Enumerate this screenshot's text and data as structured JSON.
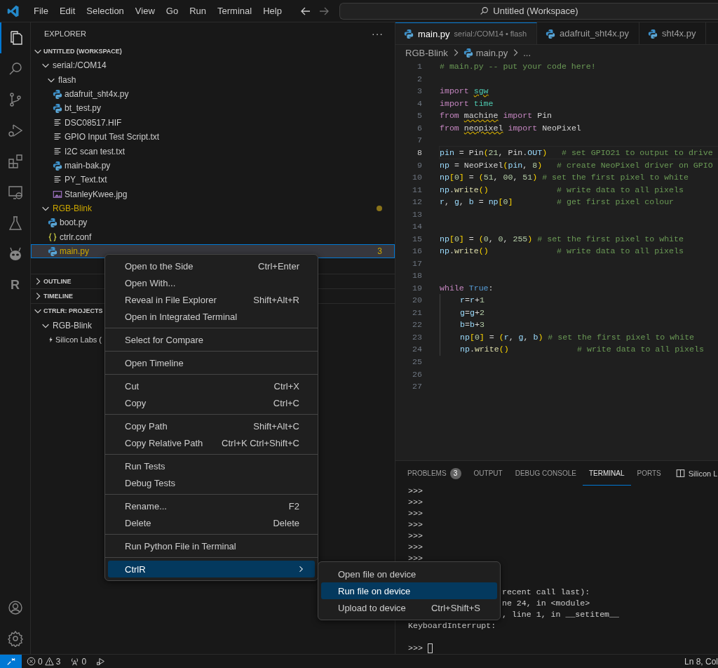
{
  "title_bar": {
    "menus": [
      "File",
      "Edit",
      "Selection",
      "View",
      "Go",
      "Run",
      "Terminal",
      "Help"
    ],
    "search": "Untitled (Workspace)"
  },
  "activity_bar": {
    "items": [
      {
        "kind": "files",
        "selected": true
      },
      {
        "kind": "search",
        "selected": false
      },
      {
        "kind": "source-control",
        "selected": false
      },
      {
        "kind": "run-debug",
        "selected": false
      },
      {
        "kind": "extensions",
        "selected": false
      },
      {
        "kind": "remote",
        "selected": false
      },
      {
        "kind": "testing",
        "selected": false
      },
      {
        "kind": "alien",
        "selected": false
      },
      {
        "kind": "letter",
        "text": "R",
        "selected": false
      }
    ],
    "bottom": [
      {
        "kind": "account"
      },
      {
        "kind": "settings"
      }
    ]
  },
  "sidebar": {
    "title": "EXPLORER",
    "more": "···",
    "sections": [
      {
        "title": "UNTITLED (WORKSPACE)",
        "expanded": true,
        "tree": [
          {
            "label": "serial:/COM14",
            "kind": "folder",
            "expanded": true,
            "selected": false,
            "warning": false,
            "children": [
              {
                "label": "flash",
                "kind": "folder",
                "expanded": true,
                "selected": false,
                "warning": false,
                "children": [
                  {
                    "label": "adafruit_sht4x.py",
                    "kind": "python",
                    "selected": false,
                    "warning": false
                  },
                  {
                    "label": "bt_test.py",
                    "kind": "python",
                    "selected": false,
                    "warning": false
                  },
                  {
                    "label": "DSC08517.HIF",
                    "kind": "text",
                    "selected": false,
                    "warning": false
                  },
                  {
                    "label": "GPIO Input Test Script.txt",
                    "kind": "text",
                    "selected": false,
                    "warning": false
                  },
                  {
                    "label": "I2C scan test.txt",
                    "kind": "text",
                    "selected": false,
                    "warning": false
                  },
                  {
                    "label": "main-bak.py",
                    "kind": "python",
                    "selected": false,
                    "warning": false
                  },
                  {
                    "label": "PY_Text.txt",
                    "kind": "text",
                    "selected": false,
                    "warning": false
                  },
                  {
                    "label": "StanleyKwee.jpg",
                    "kind": "image",
                    "selected": false,
                    "warning": false
                  }
                ]
              }
            ]
          },
          {
            "label": "RGB-Blink",
            "kind": "folder",
            "expanded": true,
            "selected": false,
            "warning": true,
            "children": [
              {
                "label": "boot.py",
                "kind": "python",
                "selected": false,
                "warning": false
              },
              {
                "label": "ctrlr.conf",
                "kind": "json",
                "selected": false,
                "warning": false
              },
              {
                "label": "main.py",
                "kind": "python",
                "selected": true,
                "warning": true,
                "problems": "3"
              }
            ]
          }
        ]
      },
      {
        "title": "OUTLINE",
        "expanded": false
      },
      {
        "title": "TIMELINE",
        "expanded": false
      },
      {
        "title": "CTRLR: PROJECTS",
        "expanded": true,
        "tree": [
          {
            "label": "RGB-Blink",
            "kind": "folder",
            "expanded": true,
            "selected": false,
            "warning": false,
            "children": [
              {
                "label": "Silicon Labs (",
                "kind": "device",
                "selected": false,
                "warning": false
              }
            ]
          }
        ]
      }
    ]
  },
  "editor": {
    "tabs": [
      {
        "label": "main.py",
        "description": "serial:/COM14 • flash",
        "selected": true
      },
      {
        "label": "adafruit_sht4x.py",
        "selected": false
      },
      {
        "label": "sht4x.py",
        "selected": false
      }
    ],
    "breadcrumb": [
      {
        "label": "RGB-Blink",
        "kind": "folder"
      },
      {
        "label": "main.py",
        "kind": "python"
      },
      {
        "label": "...",
        "kind": "more"
      }
    ],
    "lines": [
      {
        "number": "1",
        "current": false,
        "indented": false,
        "tokens": [
          {
            "kind": "c",
            "text": "# main.py -- put your code here!"
          }
        ]
      },
      {
        "number": "2",
        "current": false,
        "indented": false
      },
      {
        "number": "3",
        "current": false,
        "indented": false,
        "tokens": [
          {
            "kind": "k",
            "text": "import "
          },
          {
            "kind": "mw",
            "text": "sgw"
          }
        ]
      },
      {
        "number": "4",
        "current": false,
        "indented": false,
        "tokens": [
          {
            "kind": "k",
            "text": "import "
          },
          {
            "kind": "m",
            "text": "time"
          }
        ]
      },
      {
        "number": "5",
        "current": false,
        "indented": false,
        "tokens": [
          {
            "kind": "k",
            "text": "from "
          },
          {
            "kind": "pw",
            "text": "machine"
          },
          {
            "kind": "k",
            "text": " import "
          },
          {
            "kind": "t",
            "text": "Pin"
          }
        ]
      },
      {
        "number": "6",
        "current": false,
        "indented": false,
        "tokens": [
          {
            "kind": "k",
            "text": "from "
          },
          {
            "kind": "pw",
            "text": "neopixel"
          },
          {
            "kind": "k",
            "text": " import "
          },
          {
            "kind": "t",
            "text": "NeoPixel"
          }
        ]
      },
      {
        "number": "7",
        "current": false,
        "indented": false
      },
      {
        "number": "8",
        "current": true,
        "indented": false,
        "tokens": [
          {
            "kind": "v",
            "text": "pin"
          },
          {
            "kind": "o",
            "text": " = "
          },
          {
            "kind": "t",
            "text": "Pin"
          },
          {
            "kind": "b",
            "text": "("
          },
          {
            "kind": "n",
            "text": "21"
          },
          {
            "kind": "o",
            "text": ", "
          },
          {
            "kind": "t",
            "text": "Pin"
          },
          {
            "kind": "o",
            "text": "."
          },
          {
            "kind": "v",
            "text": "OUT"
          },
          {
            "kind": "b",
            "text": ")"
          },
          {
            "kind": "c",
            "text": "   # set GPIO21 to output to drive"
          }
        ]
      },
      {
        "number": "9",
        "current": false,
        "indented": false,
        "tokens": [
          {
            "kind": "v",
            "text": "np"
          },
          {
            "kind": "o",
            "text": " = "
          },
          {
            "kind": "t",
            "text": "NeoPixel"
          },
          {
            "kind": "b",
            "text": "("
          },
          {
            "kind": "v",
            "text": "pin"
          },
          {
            "kind": "o",
            "text": ", "
          },
          {
            "kind": "n",
            "text": "8"
          },
          {
            "kind": "b",
            "text": ")"
          },
          {
            "kind": "c",
            "text": "   # create NeoPixel driver on GPIO"
          }
        ]
      },
      {
        "number": "10",
        "current": false,
        "indented": false,
        "tokens": [
          {
            "kind": "v",
            "text": "np"
          },
          {
            "kind": "b",
            "text": "["
          },
          {
            "kind": "n",
            "text": "0"
          },
          {
            "kind": "b",
            "text": "]"
          },
          {
            "kind": "o",
            "text": " = "
          },
          {
            "kind": "b",
            "text": "("
          },
          {
            "kind": "n",
            "text": "51"
          },
          {
            "kind": "o",
            "text": ", "
          },
          {
            "kind": "n",
            "text": "00"
          },
          {
            "kind": "o",
            "text": ", "
          },
          {
            "kind": "n",
            "text": "51"
          },
          {
            "kind": "b",
            "text": ")"
          },
          {
            "kind": "c",
            "text": " # set the first pixel to white"
          }
        ]
      },
      {
        "number": "11",
        "current": false,
        "indented": false,
        "tokens": [
          {
            "kind": "v",
            "text": "np"
          },
          {
            "kind": "o",
            "text": "."
          },
          {
            "kind": "f",
            "text": "write"
          },
          {
            "kind": "b",
            "text": "()"
          },
          {
            "kind": "c",
            "text": "              # write data to all pixels"
          }
        ]
      },
      {
        "number": "12",
        "current": false,
        "indented": false,
        "tokens": [
          {
            "kind": "v",
            "text": "r"
          },
          {
            "kind": "o",
            "text": ", "
          },
          {
            "kind": "v",
            "text": "g"
          },
          {
            "kind": "o",
            "text": ", "
          },
          {
            "kind": "v",
            "text": "b"
          },
          {
            "kind": "o",
            "text": " = "
          },
          {
            "kind": "v",
            "text": "np"
          },
          {
            "kind": "b",
            "text": "["
          },
          {
            "kind": "n",
            "text": "0"
          },
          {
            "kind": "b",
            "text": "]"
          },
          {
            "kind": "c",
            "text": "         # get first pixel colour"
          }
        ]
      },
      {
        "number": "13",
        "current": false,
        "indented": false
      },
      {
        "number": "14",
        "current": false,
        "indented": false
      },
      {
        "number": "15",
        "current": false,
        "indented": false,
        "tokens": [
          {
            "kind": "v",
            "text": "np"
          },
          {
            "kind": "b",
            "text": "["
          },
          {
            "kind": "n",
            "text": "0"
          },
          {
            "kind": "b",
            "text": "]"
          },
          {
            "kind": "o",
            "text": " = "
          },
          {
            "kind": "b",
            "text": "("
          },
          {
            "kind": "n",
            "text": "0"
          },
          {
            "kind": "o",
            "text": ", "
          },
          {
            "kind": "n",
            "text": "0"
          },
          {
            "kind": "o",
            "text": ", "
          },
          {
            "kind": "n",
            "text": "255"
          },
          {
            "kind": "b",
            "text": ")"
          },
          {
            "kind": "c",
            "text": " # set the first pixel to white"
          }
        ]
      },
      {
        "number": "16",
        "current": false,
        "indented": false,
        "tokens": [
          {
            "kind": "v",
            "text": "np"
          },
          {
            "kind": "o",
            "text": "."
          },
          {
            "kind": "f",
            "text": "write"
          },
          {
            "kind": "b",
            "text": "()"
          },
          {
            "kind": "c",
            "text": "              # write data to all pixels"
          }
        ]
      },
      {
        "number": "17",
        "current": false,
        "indented": false
      },
      {
        "number": "18",
        "current": false,
        "indented": false
      },
      {
        "number": "19",
        "current": false,
        "indented": false,
        "tokens": [
          {
            "kind": "k",
            "text": "while "
          },
          {
            "kind": "q",
            "text": "True"
          },
          {
            "kind": "o",
            "text": ":"
          }
        ]
      },
      {
        "number": "20",
        "current": false,
        "indented": true,
        "tokens": [
          {
            "kind": "v",
            "text": "r"
          },
          {
            "kind": "o",
            "text": "="
          },
          {
            "kind": "v",
            "text": "r"
          },
          {
            "kind": "o",
            "text": "+"
          },
          {
            "kind": "n",
            "text": "1"
          }
        ]
      },
      {
        "number": "21",
        "current": false,
        "indented": true,
        "tokens": [
          {
            "kind": "v",
            "text": "g"
          },
          {
            "kind": "o",
            "text": "="
          },
          {
            "kind": "v",
            "text": "g"
          },
          {
            "kind": "o",
            "text": "+"
          },
          {
            "kind": "n",
            "text": "2"
          }
        ]
      },
      {
        "number": "22",
        "current": false,
        "indented": true,
        "tokens": [
          {
            "kind": "v",
            "text": "b"
          },
          {
            "kind": "o",
            "text": "="
          },
          {
            "kind": "v",
            "text": "b"
          },
          {
            "kind": "o",
            "text": "+"
          },
          {
            "kind": "n",
            "text": "3"
          }
        ]
      },
      {
        "number": "23",
        "current": false,
        "indented": true,
        "tokens": [
          {
            "kind": "v",
            "text": "np"
          },
          {
            "kind": "b",
            "text": "["
          },
          {
            "kind": "n",
            "text": "0"
          },
          {
            "kind": "b",
            "text": "]"
          },
          {
            "kind": "o",
            "text": " = "
          },
          {
            "kind": "b",
            "text": "("
          },
          {
            "kind": "v",
            "text": "r"
          },
          {
            "kind": "o",
            "text": ", "
          },
          {
            "kind": "v",
            "text": "g"
          },
          {
            "kind": "o",
            "text": ", "
          },
          {
            "kind": "v",
            "text": "b"
          },
          {
            "kind": "b",
            "text": ")"
          },
          {
            "kind": "c",
            "text": " # set the first pixel to white"
          }
        ]
      },
      {
        "number": "24",
        "current": false,
        "indented": true,
        "tokens": [
          {
            "kind": "v",
            "text": "np"
          },
          {
            "kind": "o",
            "text": "."
          },
          {
            "kind": "f",
            "text": "write"
          },
          {
            "kind": "b",
            "text": "()"
          },
          {
            "kind": "c",
            "text": "              # write data to all pixels"
          }
        ]
      },
      {
        "number": "25",
        "current": false,
        "indented": false
      },
      {
        "number": "26",
        "current": false,
        "indented": false
      },
      {
        "number": "27",
        "current": false,
        "indented": false
      }
    ]
  },
  "panel": {
    "tabs": [
      {
        "label": "PROBLEMS",
        "badge": "3",
        "selected": false
      },
      {
        "label": "OUTPUT",
        "selected": false
      },
      {
        "label": "DEBUG CONSOLE",
        "selected": false
      },
      {
        "label": "TERMINAL",
        "selected": true
      },
      {
        "label": "PORTS",
        "selected": false
      }
    ],
    "terminal_name": "Silicon L",
    "terminal": [
      {
        "text": ">>>",
        "kind": "full"
      },
      {
        "text": ">>>",
        "kind": "full"
      },
      {
        "text": ">>>",
        "kind": "full"
      },
      {
        "text": ">>>",
        "kind": "full"
      },
      {
        "text": ">>>",
        "kind": "full"
      },
      {
        "text": ">>>",
        "kind": "full"
      },
      {
        "text": ">>>",
        "kind": "full"
      },
      {
        "text": "recent call last):",
        "kind": "partial"
      },
      {
        "text": "ne 24, in <module>",
        "kind": "partial"
      },
      {
        "text": ", line 1, in __setitem__",
        "kind": "partial"
      },
      {
        "text": "KeyboardInterrupt:",
        "kind": "full"
      },
      {
        "text": ">>>",
        "kind": "prompt"
      }
    ]
  },
  "context_menu": {
    "groups": [
      [
        {
          "label": "Open to the Side",
          "shortcut": "Ctrl+Enter",
          "selected": false
        },
        {
          "label": "Open With...",
          "selected": false
        },
        {
          "label": "Reveal in File Explorer",
          "shortcut": "Shift+Alt+R",
          "selected": false
        },
        {
          "label": "Open in Integrated Terminal",
          "selected": false
        }
      ],
      [
        {
          "label": "Select for Compare",
          "selected": false
        }
      ],
      [
        {
          "label": "Open Timeline",
          "selected": false
        }
      ],
      [
        {
          "label": "Cut",
          "shortcut": "Ctrl+X",
          "selected": false
        },
        {
          "label": "Copy",
          "shortcut": "Ctrl+C",
          "selected": false
        }
      ],
      [
        {
          "label": "Copy Path",
          "shortcut": "Shift+Alt+C",
          "selected": false
        },
        {
          "label": "Copy Relative Path",
          "shortcut": "Ctrl+K Ctrl+Shift+C",
          "selected": false
        }
      ],
      [
        {
          "label": "Run Tests",
          "selected": false
        },
        {
          "label": "Debug Tests",
          "selected": false
        }
      ],
      [
        {
          "label": "Rename...",
          "shortcut": "F2",
          "selected": false
        },
        {
          "label": "Delete",
          "shortcut": "Delete",
          "selected": false
        }
      ],
      [
        {
          "label": "Run Python File in Terminal",
          "selected": false
        }
      ],
      [
        {
          "label": "CtrlR",
          "submenu": true,
          "selected": true
        }
      ]
    ],
    "submenu": [
      {
        "label": "Open file on device",
        "selected": false
      },
      {
        "label": "Run file on device",
        "selected": true
      },
      {
        "label": "Upload to device",
        "shortcut": "Ctrl+Shift+S",
        "selected": false
      }
    ]
  },
  "status_bar": {
    "errors": "0",
    "warnings": "3",
    "ports": "0",
    "position": "Ln 8, Col"
  }
}
